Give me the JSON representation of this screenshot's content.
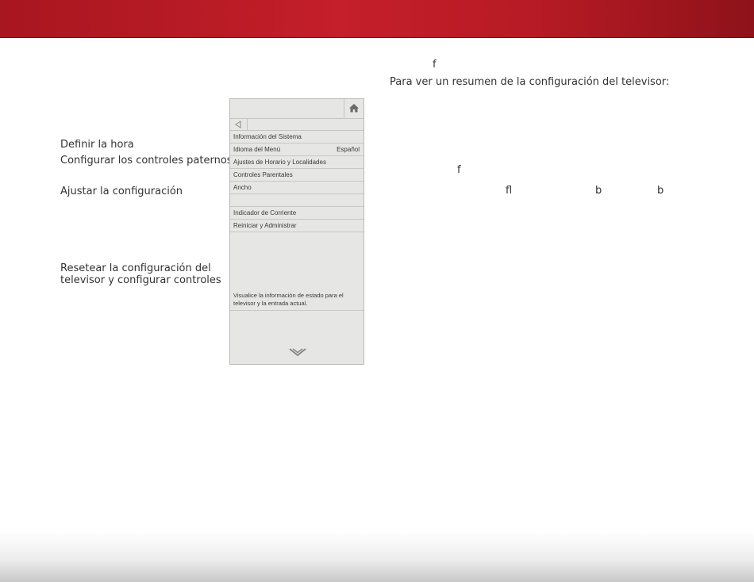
{
  "header": {
    "color": "#c41f2a"
  },
  "left_labels": {
    "set_time": "Definir la hora",
    "parental": "Configurar los controles paternos",
    "adjust": "Ajustar la configuración",
    "reset_line1": "Resetear la configuración del",
    "reset_line2": "televisor y configurar controles"
  },
  "right_text": {
    "glyph_f_top": "f",
    "summary": "Para ver un resumen de la configuración del televisor:",
    "glyph_f_mid": "f",
    "glyph_fl": "fl",
    "glyph_b1": "b",
    "glyph_b2": "b"
  },
  "tv_menu": {
    "items": [
      {
        "label": "Información del Sistema",
        "value": ""
      },
      {
        "label": "Idioma del Menú",
        "value": "Español"
      },
      {
        "label": "Ajustes de Horario y Localidades",
        "value": ""
      },
      {
        "label": "Controles Parentales",
        "value": ""
      },
      {
        "label": "Ancho",
        "value": ""
      },
      {
        "label": "",
        "value": ""
      },
      {
        "label": "Indicador de Corriente",
        "value": ""
      },
      {
        "label": "Reiniciar y Administrar",
        "value": ""
      }
    ],
    "description": "Visualice la información de estado para el televisor y la entrada actual.",
    "home_icon": "home-icon",
    "back_icon": "back-arrow-icon",
    "more_icon": "chevron-down-icon"
  }
}
